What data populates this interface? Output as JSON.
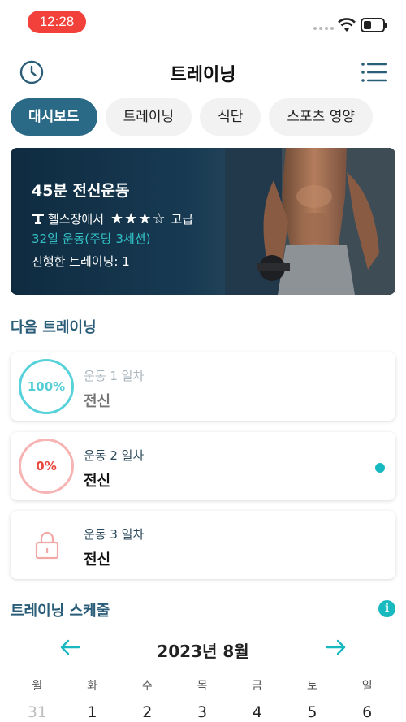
{
  "status_bar": {
    "time": "12:28"
  },
  "header": {
    "title": "트레이닝",
    "left_icon": "clock-icon",
    "right_icon": "menu-icon"
  },
  "tabs": [
    {
      "label": "대시보드",
      "active": true
    },
    {
      "label": "트레이닝",
      "active": false
    },
    {
      "label": "식단",
      "active": false
    },
    {
      "label": "스포츠 영양",
      "active": false
    }
  ],
  "hero": {
    "title": "45분 전신운동",
    "location": "헬스장에서",
    "rating_stars": 3,
    "rating_max": 4,
    "level": "고급",
    "program": "32일 운동(주당 3세션)",
    "completed": "진행한 트레이닝: 1"
  },
  "next_training": {
    "title": "다음 트레이닝",
    "items": [
      {
        "progress": "100%",
        "day": "운동 1 일차",
        "name": "전신",
        "state": "done"
      },
      {
        "progress": "0%",
        "day": "운동 2 일차",
        "name": "전신",
        "state": "current"
      },
      {
        "progress": "",
        "day": "운동 3 일차",
        "name": "전신",
        "state": "locked"
      }
    ]
  },
  "schedule": {
    "title": "트레이닝 스케줄",
    "month": "2023년 8월",
    "weekdays": [
      "월",
      "화",
      "수",
      "목",
      "금",
      "토",
      "일"
    ],
    "dates": [
      "31",
      "1",
      "2",
      "3",
      "4",
      "5",
      "6"
    ]
  },
  "colors": {
    "accent": "#2a6a86",
    "teal": "#17b8bf",
    "status_red": "#f2413a"
  }
}
